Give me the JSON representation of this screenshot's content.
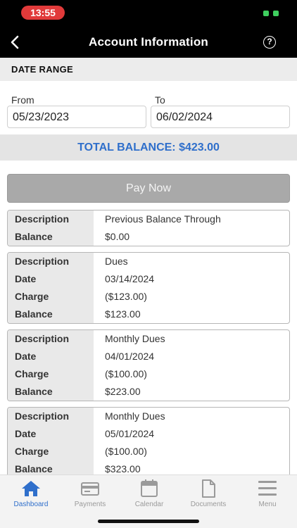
{
  "status": {
    "time": "13:55"
  },
  "header": {
    "title": "Account Information",
    "help_glyph": "?"
  },
  "date_range": {
    "heading": "DATE RANGE",
    "from_label": "From",
    "from_value": "05/23/2023",
    "to_label": "To",
    "to_value": "06/02/2024"
  },
  "total_balance": "TOTAL BALANCE: $423.00",
  "pay_now_label": "Pay Now",
  "entries": [
    {
      "rows": [
        {
          "k": "Description",
          "v": "Previous Balance Through"
        },
        {
          "k": "Balance",
          "v": "$0.00"
        }
      ]
    },
    {
      "rows": [
        {
          "k": "Description",
          "v": "Dues"
        },
        {
          "k": "Date",
          "v": "03/14/2024"
        },
        {
          "k": "Charge",
          "v": "($123.00)"
        },
        {
          "k": "Balance",
          "v": "$123.00"
        }
      ]
    },
    {
      "rows": [
        {
          "k": "Description",
          "v": "Monthly Dues"
        },
        {
          "k": "Date",
          "v": "04/01/2024"
        },
        {
          "k": "Charge",
          "v": "($100.00)"
        },
        {
          "k": "Balance",
          "v": "$223.00"
        }
      ]
    },
    {
      "rows": [
        {
          "k": "Description",
          "v": "Monthly Dues"
        },
        {
          "k": "Date",
          "v": "05/01/2024"
        },
        {
          "k": "Charge",
          "v": "($100.00)"
        },
        {
          "k": "Balance",
          "v": "$323.00"
        }
      ]
    }
  ],
  "tabs": [
    {
      "label": "Dashboard",
      "icon": "home-icon",
      "active": true
    },
    {
      "label": "Payments",
      "icon": "credit-card-icon",
      "active": false
    },
    {
      "label": "Calendar",
      "icon": "calendar-icon",
      "active": false
    },
    {
      "label": "Documents",
      "icon": "document-icon",
      "active": false
    },
    {
      "label": "Menu",
      "icon": "menu-icon",
      "active": false
    }
  ],
  "colors": {
    "accent": "#2f6fcb",
    "status_pill": "#e13a3a",
    "pay_button": "#a9a9a9"
  }
}
